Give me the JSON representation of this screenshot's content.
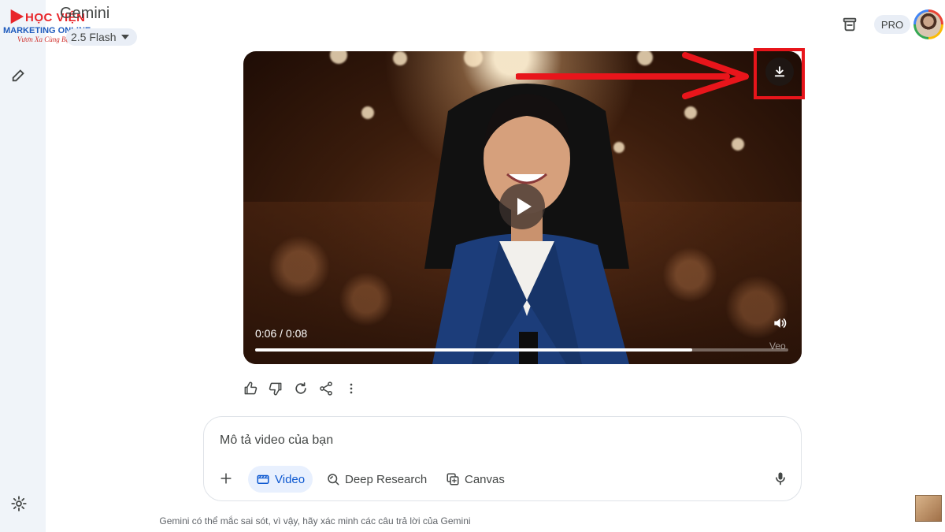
{
  "logo": {
    "line1": "HỌC VIỆN",
    "line2": "MARKETING ONLINE",
    "line3": "Vươn Xa Cùng Bạn"
  },
  "header": {
    "app_title": "Gemini",
    "model_label": "2.5 Flash",
    "pro_badge": "PRO"
  },
  "video": {
    "time_readout": "0:06 / 0:08",
    "progress_fraction": 0.82,
    "watermark": "Veo"
  },
  "prompt": {
    "placeholder": "Mô tả video của bạn",
    "tools": [
      {
        "label": "Video",
        "icon": "video-icon",
        "active": true
      },
      {
        "label": "Deep Research",
        "icon": "deep-research-icon",
        "active": false
      },
      {
        "label": "Canvas",
        "icon": "canvas-icon",
        "active": false
      }
    ]
  },
  "footer": {
    "disclaimer": "Gemini có thể mắc sai sót, vì vậy, hãy xác minh các câu trả lời của Gemini"
  },
  "colors": {
    "annotation_red": "#e8151b",
    "accent_blue": "#0b57d0",
    "sidebar_bg": "#f0f4f9"
  }
}
